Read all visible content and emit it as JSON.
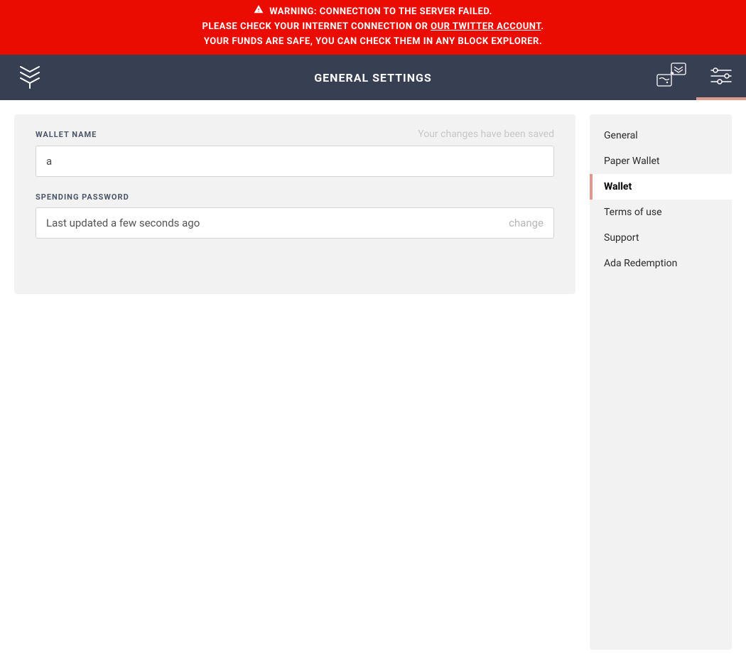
{
  "colors": {
    "banner_bg": "#ea0c00",
    "header_bg": "#373f52",
    "accent": "#dc9a8e",
    "panel_bg": "#f2f2f2"
  },
  "warning": {
    "line1": "WARNING: CONNECTION TO THE SERVER FAILED.",
    "line2_pre": "PLEASE CHECK YOUR INTERNET CONNECTION OR ",
    "line2_link": "OUR TWITTER ACCOUNT",
    "line2_post": ".",
    "line3": "YOUR FUNDS ARE SAFE, YOU CAN CHECK THEM IN ANY BLOCK EXPLORER."
  },
  "header": {
    "title": "GENERAL SETTINGS",
    "icons": {
      "logo": "app-logo",
      "action1": "wallets-stack",
      "action2": "settings-sliders"
    }
  },
  "main": {
    "wallet_name": {
      "label": "WALLET NAME",
      "save_status": "Your changes have been saved",
      "value": "a"
    },
    "spending_password": {
      "label": "SPENDING PASSWORD",
      "updated_text": "Last updated a few seconds ago",
      "change_label": "change"
    }
  },
  "sidebar": {
    "items": [
      {
        "label": "General",
        "selected": false
      },
      {
        "label": "Paper Wallet",
        "selected": false
      },
      {
        "label": "Wallet",
        "selected": true
      },
      {
        "label": "Terms of use",
        "selected": false
      },
      {
        "label": "Support",
        "selected": false
      },
      {
        "label": "Ada Redemption",
        "selected": false
      }
    ]
  }
}
